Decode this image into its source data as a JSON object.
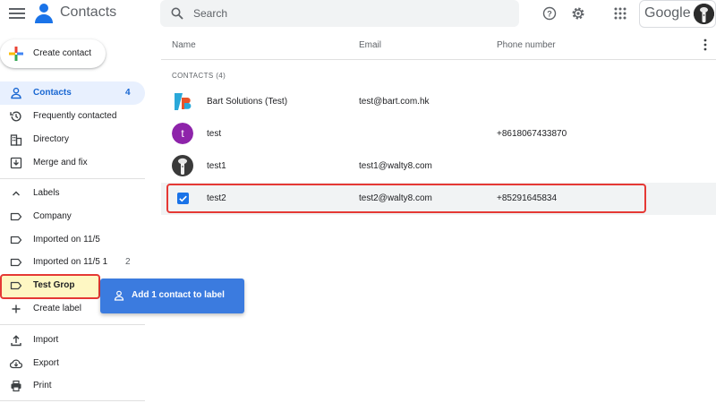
{
  "header": {
    "app_title": "Contacts",
    "search_placeholder": "Search",
    "account_brand": "Google"
  },
  "sidebar": {
    "create_label": "Create contact",
    "items": [
      {
        "label": "Contacts",
        "count": "4",
        "icon": "person-icon",
        "active": true
      },
      {
        "label": "Frequently contacted",
        "count": "",
        "icon": "history-icon"
      },
      {
        "label": "Directory",
        "count": "",
        "icon": "directory-icon"
      },
      {
        "label": "Merge and fix",
        "count": "",
        "icon": "merge-icon"
      }
    ],
    "labels_header": "Labels",
    "labels": [
      {
        "label": "Company",
        "count": ""
      },
      {
        "label": "Imported on 11/5",
        "count": ""
      },
      {
        "label": "Imported on 11/5 1",
        "count": "2"
      },
      {
        "label": "Test Grop",
        "count": ""
      }
    ],
    "create_label_item": "Create label",
    "tools": [
      {
        "label": "Import",
        "icon": "upload-icon"
      },
      {
        "label": "Export",
        "icon": "cloud-download-icon"
      },
      {
        "label": "Print",
        "icon": "printer-icon"
      }
    ],
    "add_to_label": "Add 1 contact to label"
  },
  "list": {
    "columns": {
      "name": "Name",
      "email": "Email",
      "phone": "Phone number"
    },
    "section_label": "CONTACTS (4)",
    "rows": [
      {
        "name": "Bart Solutions (Test)",
        "email": "test@bart.com.hk",
        "phone": "",
        "avatar": "bart-logo"
      },
      {
        "name": "test",
        "email": "",
        "phone": "+8618067433870",
        "avatar_letter": "t"
      },
      {
        "name": "test1",
        "email": "test1@walty8.com",
        "phone": "",
        "avatar": "photo"
      },
      {
        "name": "test2",
        "email": "test2@walty8.com",
        "phone": "+85291645834",
        "selected": true
      }
    ]
  },
  "colors": {
    "accent": "#1a73e8",
    "active_bg": "#e8f0fe",
    "highlight_border": "#e53935",
    "highlight_bg": "#fef7c3",
    "label_button": "#3b7bdf",
    "avatar_purple": "#8e24aa"
  }
}
